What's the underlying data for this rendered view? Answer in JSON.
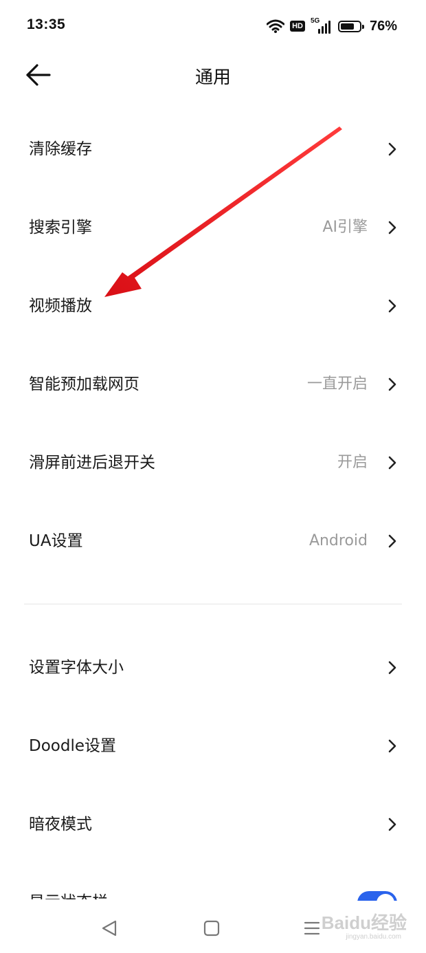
{
  "status_bar": {
    "time": "13:35",
    "network_hd": "HD",
    "network_type": "5G",
    "battery_percent": "76%",
    "battery_level": 0.76
  },
  "header": {
    "title": "通用",
    "back_icon": "arrow-left-icon"
  },
  "settings": {
    "items": [
      {
        "label": "清除缓存",
        "value": ""
      },
      {
        "label": "搜索引擎",
        "value": "AI引擎"
      },
      {
        "label": "视频播放",
        "value": ""
      },
      {
        "label": "智能预加载网页",
        "value": "一直开启"
      },
      {
        "label": "滑屏前进后退开关",
        "value": "开启"
      },
      {
        "label": "UA设置",
        "value": "Android"
      }
    ],
    "items2": [
      {
        "label": "设置字体大小",
        "value": ""
      },
      {
        "label": "Doodle设置",
        "value": ""
      },
      {
        "label": "暗夜模式",
        "value": ""
      }
    ],
    "partial_item": {
      "label": "显示状态栏",
      "toggle_on": true
    }
  },
  "annotation": {
    "arrow_color": "#e8141b"
  },
  "navbar": {
    "back_icon": "triangle-back-icon",
    "home_icon": "square-home-icon",
    "menu_icon": "menu-lines-icon"
  },
  "watermark": {
    "text": "Baidu经验",
    "sub": "jingyan.baidu.com"
  },
  "colors": {
    "accent": "#2a63ec",
    "secondary_text": "#9a9a9a"
  }
}
